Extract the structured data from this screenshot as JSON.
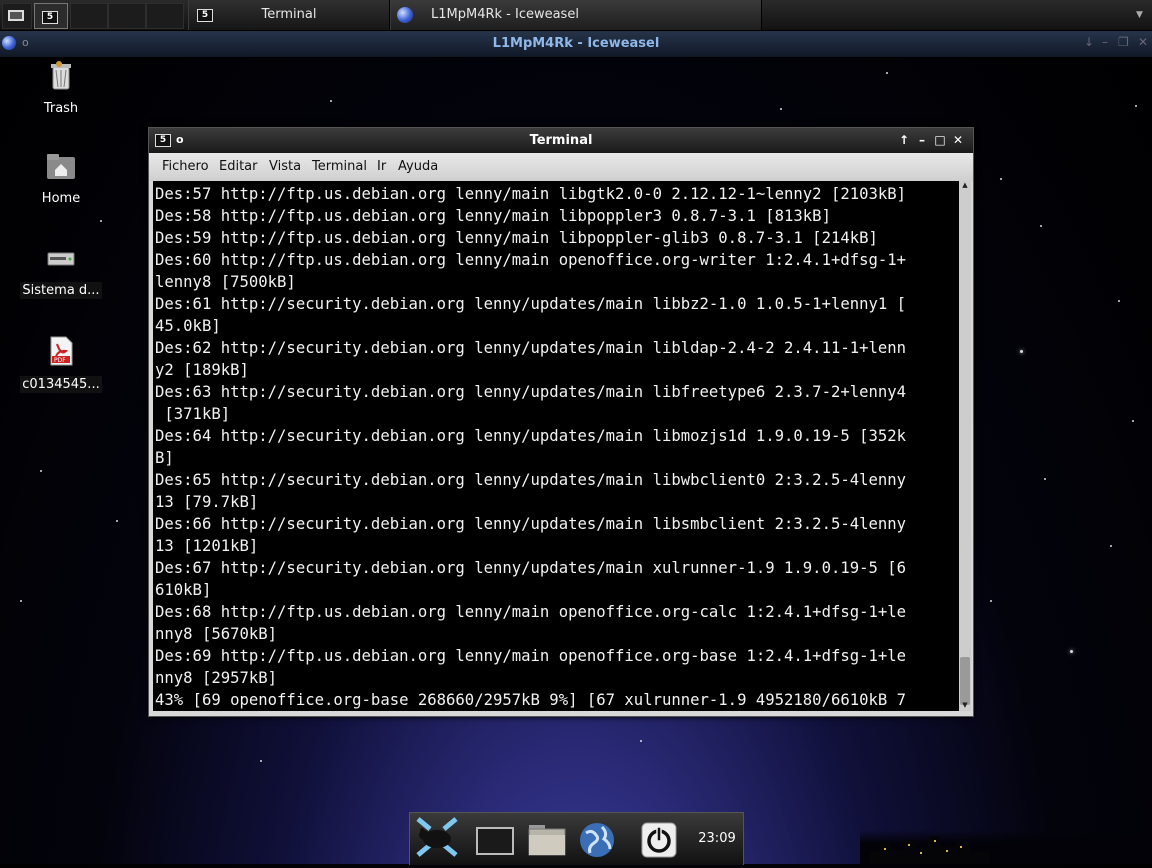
{
  "taskbar": {
    "tasks": [
      {
        "label": "Terminal",
        "icon": "terminal-icon"
      },
      {
        "label": "L1MpM4Rk - Iceweasel",
        "icon": "iceweasel-globe-icon"
      }
    ]
  },
  "browser_window": {
    "title": "L1MpM4Rk - Iceweasel"
  },
  "desktop": {
    "icons": [
      {
        "label": "Trash",
        "icon": "trash-icon"
      },
      {
        "label": "Home",
        "icon": "home-folder-icon"
      },
      {
        "label": "Sistema d...",
        "icon": "drive-icon"
      },
      {
        "label": "c0134545...",
        "icon": "pdf-file-icon"
      }
    ]
  },
  "terminal": {
    "title": "Terminal",
    "menu": [
      "Fichero",
      "Editar",
      "Vista",
      "Terminal",
      "Ir",
      "Ayuda"
    ],
    "lines": [
      "Des:57 http://ftp.us.debian.org lenny/main libgtk2.0-0 2.12.12-1~lenny2 [2103kB]",
      "Des:58 http://ftp.us.debian.org lenny/main libpoppler3 0.8.7-3.1 [813kB]",
      "Des:59 http://ftp.us.debian.org lenny/main libpoppler-glib3 0.8.7-3.1 [214kB]",
      "Des:60 http://ftp.us.debian.org lenny/main openoffice.org-writer 1:2.4.1+dfsg-1+",
      "lenny8 [7500kB]",
      "Des:61 http://security.debian.org lenny/updates/main libbz2-1.0 1.0.5-1+lenny1 [",
      "45.0kB]",
      "Des:62 http://security.debian.org lenny/updates/main libldap-2.4-2 2.4.11-1+lenn",
      "y2 [189kB]",
      "Des:63 http://security.debian.org lenny/updates/main libfreetype6 2.3.7-2+lenny4",
      " [371kB]",
      "Des:64 http://security.debian.org lenny/updates/main libmozjs1d 1.9.0.19-5 [352k",
      "B]",
      "Des:65 http://security.debian.org lenny/updates/main libwbclient0 2:3.2.5-4lenny",
      "13 [79.7kB]",
      "Des:66 http://security.debian.org lenny/updates/main libsmbclient 2:3.2.5-4lenny",
      "13 [1201kB]",
      "Des:67 http://security.debian.org lenny/updates/main xulrunner-1.9 1.9.0.19-5 [6",
      "610kB]",
      "Des:68 http://ftp.us.debian.org lenny/main openoffice.org-calc 1:2.4.1+dfsg-1+le",
      "nny8 [5670kB]",
      "Des:69 http://ftp.us.debian.org lenny/main openoffice.org-base 1:2.4.1+dfsg-1+le",
      "nny8 [2957kB]",
      "43% [69 openoffice.org-base 268660/2957kB 9%] [67 xulrunner-1.9 4952180/6610kB 7"
    ]
  },
  "dock": {
    "items": [
      "xfce-mouse-icon",
      "terminal-icon",
      "file-manager-icon",
      "web-browser-icon",
      "power-icon"
    ],
    "clock": "23:09"
  }
}
